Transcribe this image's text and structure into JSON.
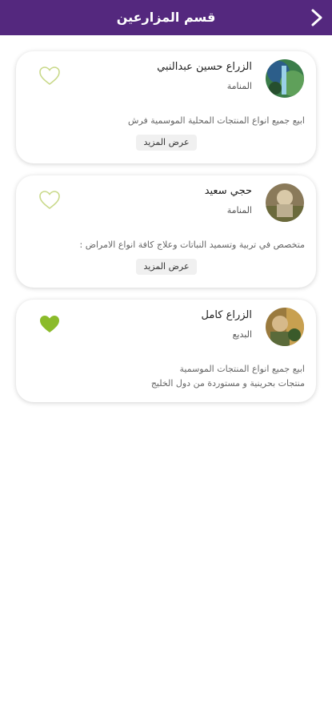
{
  "header": {
    "title": "قسم المزارعين",
    "back_icon": "chevron-right-icon"
  },
  "colors": {
    "header_bg": "#54287e",
    "heart_active": "#8bbb2a",
    "heart_outline": "#c9d98a"
  },
  "farmers": [
    {
      "name": "الزراع حسين عبدالنبي",
      "location": "المنامة",
      "description": "ابيع جميع انواع المنتجات المحلية الموسمية فرش",
      "more_label": "عرض المزيد",
      "favorite": false
    },
    {
      "name": "حجي سعيد",
      "location": "المنامة",
      "description": "متخصص في تربية وتسميد النباتات وعلاج كافة انواع الامراض :",
      "more_label": "عرض المزيد",
      "favorite": false
    },
    {
      "name": "الزراع كامل",
      "location": "البديع",
      "description_line1": "ابيع جميع انواع المنتجات الموسمية",
      "description_line2": "منتجات بحرينية و مستوردة من دول الخليج",
      "favorite": true
    }
  ]
}
